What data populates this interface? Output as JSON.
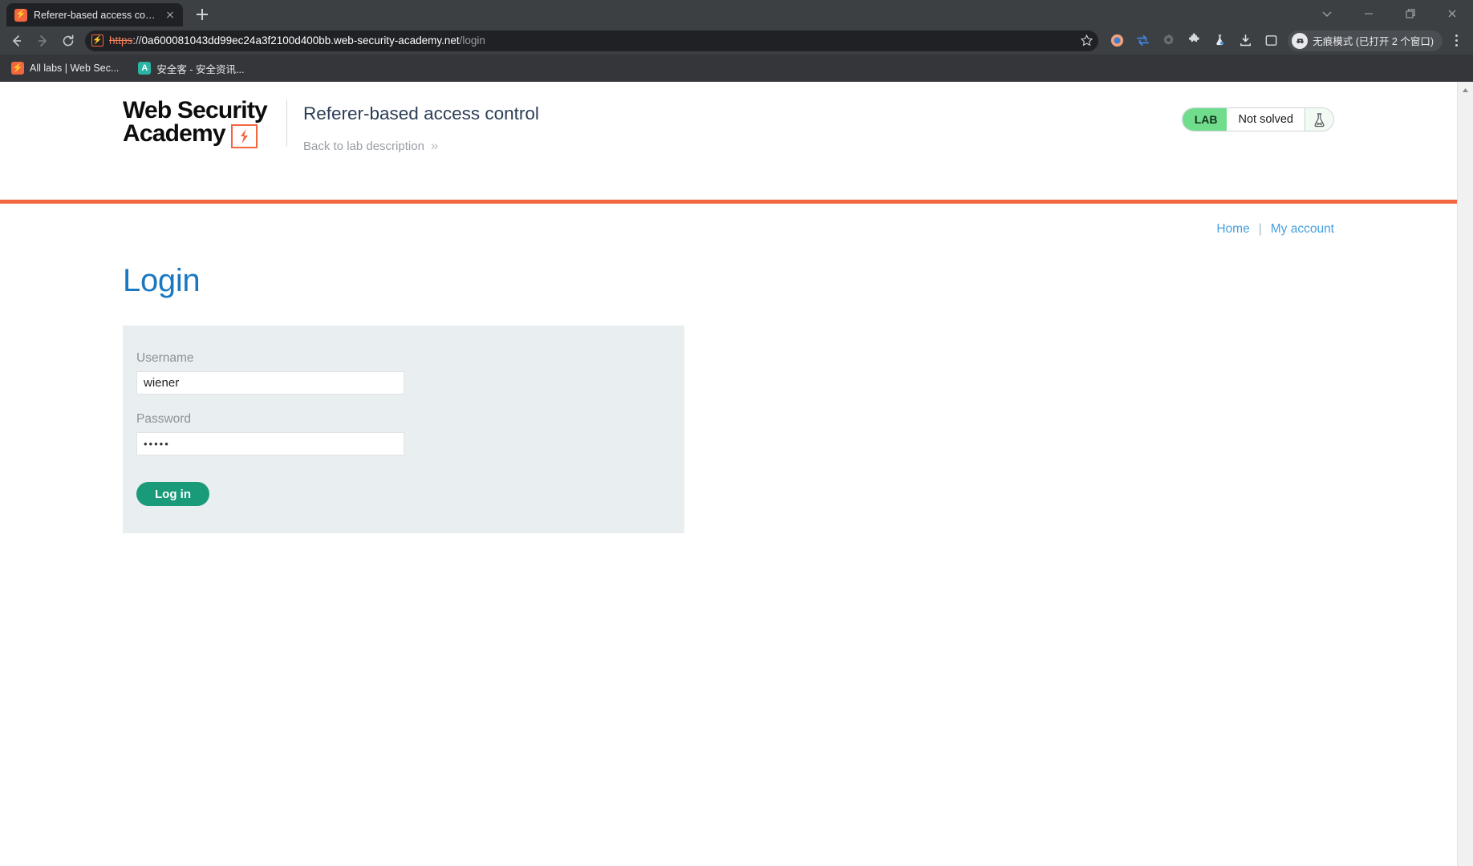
{
  "browser": {
    "tab": {
      "title": "Referer-based access control",
      "favicon_glyph": "⚡",
      "favicon_name": "portswigger-favicon",
      "close_label": "Close tab"
    },
    "new_tab_label": "New Tab",
    "window_controls": [
      {
        "name": "tab-search-button",
        "label": "Search tabs"
      },
      {
        "name": "minimize-button",
        "label": "Minimize"
      },
      {
        "name": "maximize-button",
        "label": "Maximize"
      },
      {
        "name": "close-window-button",
        "label": "Close"
      }
    ],
    "nav": {
      "back_label": "Back",
      "forward_label": "Forward",
      "reload_label": "Reload"
    },
    "omnibox": {
      "site_icon_glyph": "⚡",
      "scheme": "https",
      "separator": "://",
      "host": "0a600081043dd99ec24a3f2100d400bb.web-security-academy.net",
      "path": "/login",
      "full_url": "https://0a600081043dd99ec24a3f2100d400bb.web-security-academy.net/login",
      "bookmark_label": "Bookmark this tab"
    },
    "extensions": [
      {
        "name": "extension-orange-circle-icon",
        "label": "Extension"
      },
      {
        "name": "extension-sync-arrows-icon",
        "label": "Extension"
      },
      {
        "name": "extension-gear-icon",
        "label": "Extension"
      },
      {
        "name": "extensions-puzzle-icon",
        "label": "Extensions"
      },
      {
        "name": "extension-flask-icon",
        "label": "Extension"
      },
      {
        "name": "downloads-icon",
        "label": "Downloads"
      },
      {
        "name": "side-panel-icon",
        "label": "Side panel"
      }
    ],
    "incognito_badge": "无痕模式 (已打开 2 个窗口)",
    "menu_label": "Customize and control Google Chrome",
    "bookmarks": [
      {
        "label": "All labs | Web Sec...",
        "icon_glyph": "⚡",
        "icon_color": "#f26640"
      },
      {
        "label": "安全客 - 安全资讯...",
        "icon_glyph": "A",
        "icon_color": "#2bb3a3"
      }
    ]
  },
  "academy": {
    "logo": {
      "line1": "Web Security",
      "line2": "Academy",
      "bolt_glyph": "⚡"
    },
    "lab_title": "Referer-based access control",
    "back_link": "Back to lab description",
    "back_link_chevron": "»",
    "lab_status": {
      "tag": "LAB",
      "state": "Not solved",
      "flask_name": "flask-icon"
    }
  },
  "topnav": {
    "home": "Home",
    "separator": "|",
    "my_account": "My account"
  },
  "login": {
    "heading": "Login",
    "username_label": "Username",
    "username_value": "wiener",
    "username_placeholder": "",
    "password_label": "Password",
    "password_value": "•••••",
    "password_placeholder": "",
    "submit_label": "Log in"
  },
  "colors": {
    "accent_orange": "#f26640",
    "link_blue": "#44a1e0",
    "heading_blue": "#1a78c2",
    "button_green": "#199a79",
    "lab_tag_green": "#6fdd8b",
    "panel_gray": "#e9eef0",
    "chrome_dark": "#3c4043"
  }
}
